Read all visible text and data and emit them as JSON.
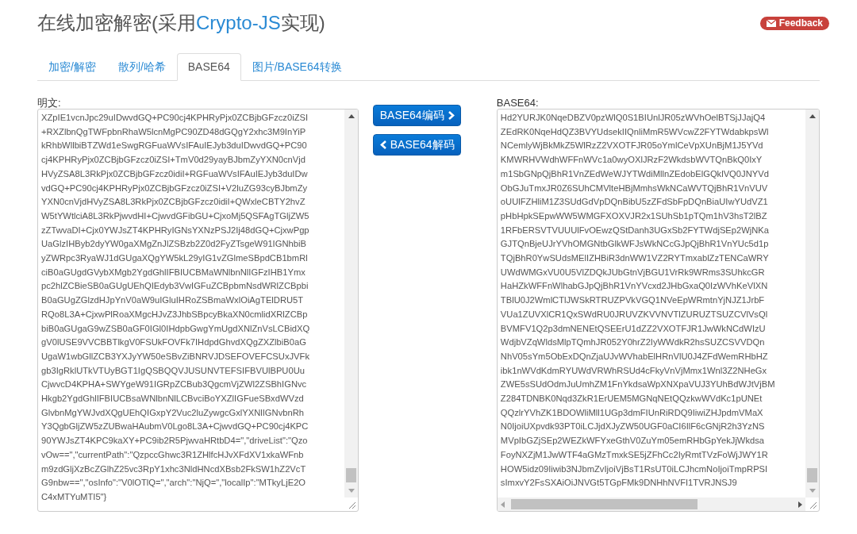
{
  "header": {
    "title_parts": [
      {
        "text": "在线加密解密(采用",
        "kind": "plain"
      },
      {
        "text": "Crypto-JS",
        "kind": "link"
      },
      {
        "text": "实现)",
        "kind": "plain"
      }
    ],
    "feedback": "Feedback"
  },
  "tabs": [
    {
      "label": "加密/解密",
      "selected": false
    },
    {
      "label": "散列/哈希",
      "selected": false
    },
    {
      "label": "BASE64",
      "selected": true
    },
    {
      "label": "图片/BASE64转换",
      "selected": false
    }
  ],
  "plaintext": {
    "label": "明文:",
    "lines": [
      "XZpIE1vcnJpc29uIDwvdGQ+PC90cj4KPHRyPjx0ZCBjbGFzcz0iZSI",
      "+RXZlbnQgTWFpbnRhaW5lcnMgPC90ZD48dGQgY2xhc3M9InYiP",
      "kRhbWllbiBTZWd1eSwgRGFuaWVsIFAuIEJyb3duIDwvdGQ+PC90",
      "cj4KPHRyPjx0ZCBjbGFzcz0iZSI+TmV0d29yayBJbmZyYXN0cnVjd",
      "HVyZSA8L3RkPjx0ZCBjbGFzcz0idiI+RGFuaWVsIFAuIEJyb3duIDw",
      "vdGQ+PC90cj4KPHRyPjx0ZCBjbGFzcz0iZSI+V2luZG93cyBJbmZy",
      "YXN0cnVjdHVyZSA8L3RkPjx0ZCBjbGFzcz0idiI+QWxleCBTY2hvZ",
      "W5tYWtlciA8L3RkPjwvdHI+CjwvdGFibGU+CjxoMj5QSFAgTGljZW5",
      "zZTwvaDI+Cjx0YWJsZT4KPHRyIGNsYXNzPSJ2Ij48dGQ+CjxwPgp",
      "UaGlzIHByb2dyYW0gaXMgZnJlZSBzb2Z0d2FyZTsgeW91IGNhbiB",
      "yZWRpc3RyaWJ1dGUgaXQgYW5kL29yIG1vZGlmeSBpdCB1bmRl",
      "ciB0aGUgdGVybXMgb2YgdGhlIFBIUCBMaWNlbnNlIGFzIHB1Ymx",
      "pc2hlZCBieSB0aGUgUEhQIEdyb3VwIGFuZCBpbmNsdWRlZCBpbi",
      "B0aGUgZGlzdHJpYnV0aW9uIGluIHRoZSBmaWxlOiAgTElDRU5T",
      "RQo8L3A+CjxwPlRoaXMgcHJvZ3JhbSBpcyBkaXN0cmlidXRlZCBp",
      "biB0aGUgaG9wZSB0aGF0IGl0IHdpbGwgYmUgdXNlZnVsLCBidXQ",
      "gV0lUSE9VVCBBTlkgV0FSUkFOVFk7IHdpdGhvdXQgZXZlbiB0aG",
      "UgaW1wbGllZCB3YXJyYW50eSBvZiBNRVJDSEFOVEFCSUxJVFk",
      "gb3IgRklUTkVTUyBGT1IgQSBQQVJUSUNVTEFSIFBVUlBPU0Uu",
      "CjwvcD4KPHA+SWYgeW91IGRpZCBub3QgcmVjZWl2ZSBhIGNvc",
      "Hkgb2YgdGhlIFBIUCBsaWNlbnNlLCBvciBoYXZlIGFueSBxdWVzd",
      "GlvbnMgYWJvdXQgUEhQIGxpY2Vuc2luZywgcGxlYXNlIGNvbnRh",
      "Y3QgbGljZW5zZUBwaHAubmV0Lgo8L3A+CjwvdGQ+PC90cj4KPC",
      "90YWJsZT4KPC9kaXY+PC9ib2R5PjwvaHRtbD4=\",\"driveList\":\"Qzo",
      "vOw==\",\"currentPath\":\"QzpccGhwc3R1ZHlfcHJvXFdXV1xkaWFnb",
      "m9zdGljXzBcZGlhZ25vc3RpY1xhc3NldHNcdXBsb2FkSW1hZ2VcT",
      "G9nbw==\",\"osInfo\":\"V0lOTlQ=\",\"arch\":\"NjQ=\",\"localIp\":\"MTkyLjE2O",
      "C4xMTYuMTI5\"}"
    ]
  },
  "buttons": [
    {
      "label": "BASE64编码",
      "kind": "encode"
    },
    {
      "label": "BASE64解码",
      "kind": "decode"
    }
  ],
  "base64": {
    "label": "BASE64:",
    "lines": [
      "Hd2YURJK0NqeDBZV0pzWlQ0S1BIUnlJR05zWVhOelBTSjJJajQ4",
      "ZEdRK0NqeHdQZ3BVYUdsekIIQnliMmR5WVcwZ2FYTWdabkpsWl",
      "NCemlyWjBkMkZ5WlRzZ2VXOTFJR05oYmlCeVpXUnBjM1J5YVd",
      "KMWRHVWdhWFFnWVc1a0wyOXlJRzF2WkdsbWVTQnBkQ0IxY",
      "m1SbGNpQjBhR1VnZEdWeWJYTWdiMllnZEdobElGQklVQ0JNYVd",
      "ObGJuTmxJR0Z6SUhCMVlteHBjMmhsWkNCaWVTQjBhR1VnVUV",
      "oUUlFZHliM1Z3SUdGdVpDQnBibU5zZFdSbFpDQnBiaUIwYUdVZ1",
      "pHbHpkSEpwWW5WMGFXOXVJR2x1SUhSb1pTQm1hV3hsT2lBZ",
      "1RFbERSVTVUUUlFvOEwzQStDanh3UGxSb2FYTWdjSEp2WjNKa",
      "GJTQnBjeUJrYVhOMGNtbGlkWFJsWkNCcGJpQjBhR1VnYUc5d1p",
      "TQjBhR0YwSUdsMElIZHBiR3dnWW1VZ2RYTmxablZzTENCaWRY",
      "UWdWMGxVU0U5VlZDQkJUbGtnVjBGU1VrRk9WRms3SUhkcGR",
      "HaHZkWFFnWlhabGJpQjBhR1VnYVcxd2JHbGxaQ0IzWVhKeVlXN",
      "TBlU0J2WmlCTlJWSkRTRUZPVkVGQ1NVeEpWRmtnYjNJZ1JrbF",
      "VUa1ZUVXlCR1QxSWdRU0JRUVZKVVNVTlZURUZTSUZCVlVsQl",
      "BVMFV1Q2p3dmNENEtQSEErU1dZZ2VXOTFJR1JwWkNCdWIzU",
      "WdjbVZqWldsMlpTQmhJR052Y0hrZ2IyWWdkR2hsSUZCSVVDQn",
      "NhV05sYm5ObExDQnZjaUJvWVhabElHRnVlU0J4ZFdWemRHbHZ",
      "ibk1nWVdKdmRYUWdVRWhRSUd4cFkyVnVjMmx1Wnl3Z2NHeGx",
      "ZWE5sSUdOdmJuUmhZM1FnYkdsaWpXNXpaVUJ3YUhBdWJtVjBM",
      "Z284TDNBK0Nqd3ZkR1ErUEM5MGNqNEtQQzkwWVdKc1pUNEt",
      "QQzlrYVhZK1BDOWliMll1UGp3dmFIUnRiRDQ9IiwiZHJpdmVMaX",
      "N0IjoiUXpvdk93PT0iLCJjdXJyZW50UGF0aCI6IlF6cGNjR2h3YzNS",
      "MVpIbGZjSEp2WEZkWFYxeGthV0ZuYm05emRHbGpYekJjWkdsa",
      "FoyNXZjM1JwWTF4aGMzTmxkSE5jZFhCc2IyRmtTVzFoWjJWY1R",
      "HOW5idz09Iiwib3NJbmZvIjoiVjBsT1RsUT0iLCJhcmNoIjoiTmpRPSI",
      "sImxvY2FsSXAiOiJNVGt5TGpFMk9DNHhNVFI1TVRJNSJ9"
    ]
  }
}
